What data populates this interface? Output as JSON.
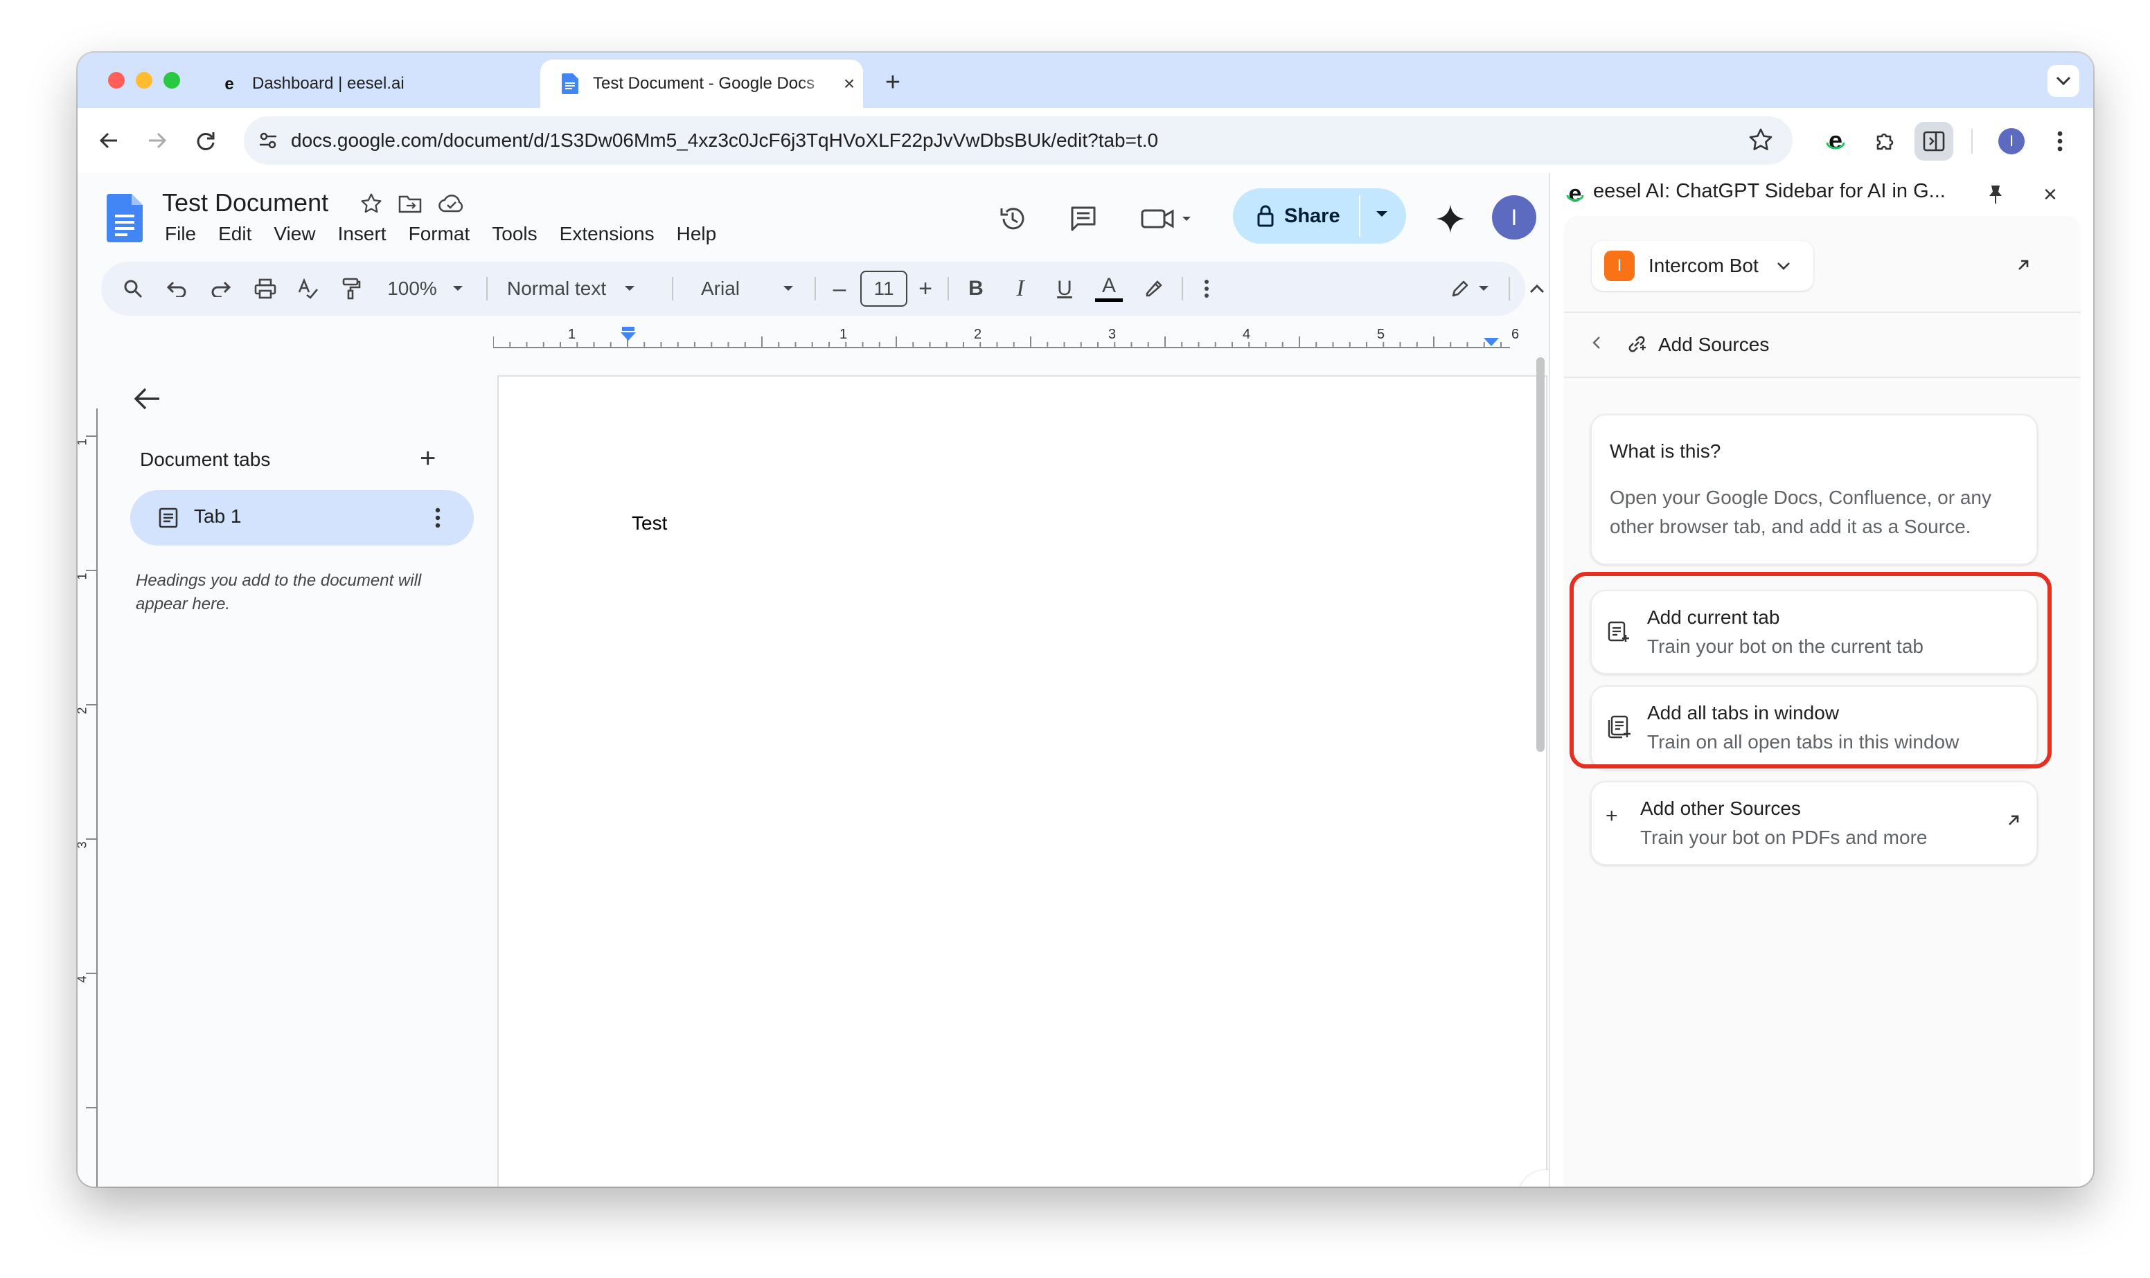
{
  "browser": {
    "tabs": [
      {
        "title": "Dashboard | eesel.ai",
        "active": false,
        "favicon": "eesel-e-icon"
      },
      {
        "title": "Test Document - Google Docs",
        "active": true,
        "favicon": "google-docs-icon"
      }
    ],
    "url": "docs.google.com/document/d/1S3Dw06Mm5_4xz3c0JcF6j3TqHVoXLF22pJvVwDbsBUk/edit?tab=t.0",
    "profile_initial": "I"
  },
  "docs": {
    "title": "Test Document",
    "menu": [
      "File",
      "Edit",
      "View",
      "Insert",
      "Format",
      "Tools",
      "Extensions",
      "Help"
    ],
    "share_label": "Share",
    "avatar_initial": "I",
    "toolbar": {
      "zoom": "100%",
      "style": "Normal text",
      "font": "Arial",
      "font_size": "11"
    },
    "ruler_labels": [
      "1",
      "1",
      "2",
      "3",
      "4",
      "5",
      "6"
    ],
    "left_ruler_labels": [
      "1",
      "1",
      "2",
      "3",
      "4"
    ],
    "outline": {
      "heading": "Document tabs",
      "tab_label": "Tab 1",
      "hint": "Headings you add to the document will appear here."
    },
    "body_text": "Test"
  },
  "sidepanel": {
    "title": "eesel AI: ChatGPT Sidebar for AI in G...",
    "bot": {
      "initial": "I",
      "name": "Intercom Bot",
      "accent": "#f97316"
    },
    "section": "Add Sources",
    "info": {
      "title": "What is this?",
      "body": "Open your Google Docs, Confluence, or any other browser tab, and add it as a Source."
    },
    "actions": [
      {
        "title": "Add current tab",
        "subtitle": "Train your bot on the current tab",
        "icon": "add-tab-icon"
      },
      {
        "title": "Add all tabs in window",
        "subtitle": "Train on all open tabs in this window",
        "icon": "add-tabs-icon"
      },
      {
        "title": "Add other Sources",
        "subtitle": "Train your bot on PDFs and more",
        "icon": "plus-icon"
      }
    ],
    "highlight_color": "#e53021"
  }
}
